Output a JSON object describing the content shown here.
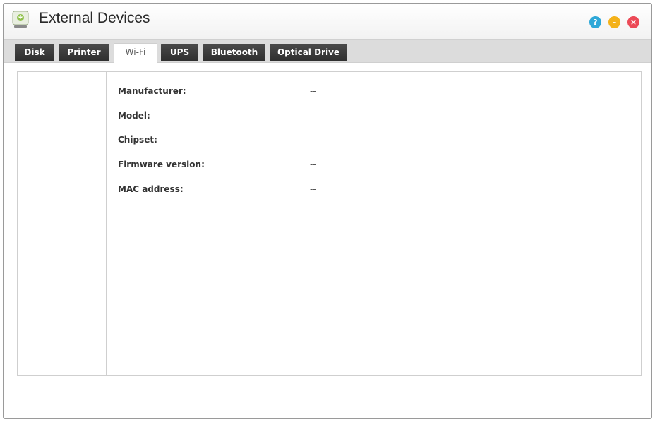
{
  "window": {
    "title": "External Devices"
  },
  "title_buttons": {
    "help_label": "?",
    "minimize_label": "–",
    "close_label": "×"
  },
  "tabs": [
    {
      "label": "Disk",
      "active": false
    },
    {
      "label": "Printer",
      "active": false
    },
    {
      "label": "Wi-Fi",
      "active": true
    },
    {
      "label": "UPS",
      "active": false
    },
    {
      "label": "Bluetooth",
      "active": false
    },
    {
      "label": "Optical Drive",
      "active": false
    }
  ],
  "wifi_info": [
    {
      "label": "Manufacturer:",
      "value": "--"
    },
    {
      "label": "Model:",
      "value": "--"
    },
    {
      "label": "Chipset:",
      "value": "--"
    },
    {
      "label": "Firmware version:",
      "value": "--"
    },
    {
      "label": "MAC address:",
      "value": "--"
    }
  ],
  "colors": {
    "help": "#2ea8d8",
    "minimize": "#f4b21a",
    "close": "#ec4a57",
    "tab_dark": "#3a3a3a",
    "tab_bar": "#dcdcdc"
  }
}
